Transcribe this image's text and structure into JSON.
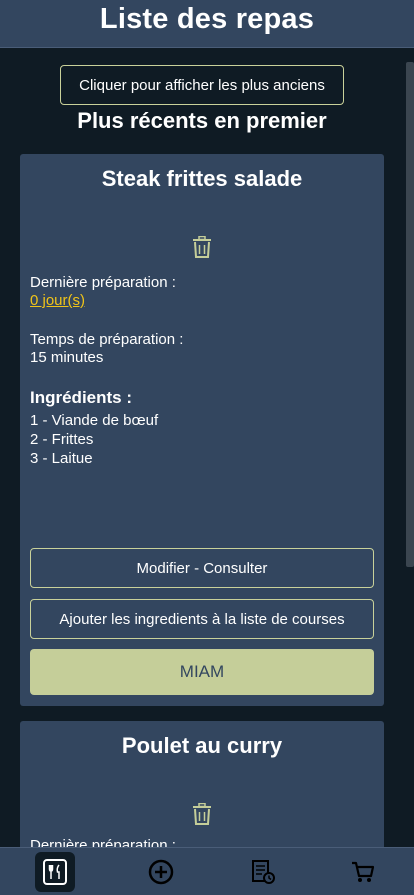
{
  "header": {
    "title": "Liste des repas"
  },
  "controls": {
    "older_button_label": "Cliquer pour afficher les plus anciens",
    "sort_label": "Plus récents en premier"
  },
  "meals": [
    {
      "name": "Steak frittes salade",
      "last_prep_label": "Dernière préparation :",
      "last_prep_value": "0 jour(s)",
      "prep_time_label": "Temps de préparation :",
      "prep_time_value": "15 minutes",
      "ingredients_title": "Ingrédients :",
      "ingredients": [
        "1 - Viande de bœuf",
        "2 - Frittes",
        "3 - Laitue"
      ],
      "modify_label": "Modifier - Consulter",
      "add_shopping_label": "Ajouter les ingredients à la liste de courses",
      "miam_label": "MIAM"
    },
    {
      "name": "Poulet au curry",
      "last_prep_label": "Dernière préparation :"
    }
  ],
  "nav": {
    "items": [
      {
        "icon": "utensils-icon",
        "active": true
      },
      {
        "icon": "add-circle-icon",
        "active": false
      },
      {
        "icon": "recipe-list-icon",
        "active": false
      },
      {
        "icon": "cart-icon",
        "active": false
      }
    ]
  },
  "colors": {
    "background": "#0f1b24",
    "card": "#33465f",
    "accent": "#c5ce99",
    "link": "#f0c419"
  }
}
